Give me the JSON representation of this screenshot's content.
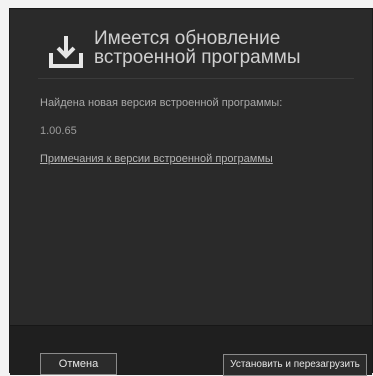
{
  "dialog": {
    "title": "Имеется обновление встроенной программы",
    "icon": "download-icon",
    "message": "Найдена новая версия встроенной программы:",
    "version": "1.00.65",
    "release_notes_link": "Примечания к версии встроенной программы"
  },
  "footer": {
    "cancel_label": "Отмена",
    "install_label": "Установить и перезагрузить"
  },
  "colors": {
    "dialog_bg": "#2a2a2a",
    "footer_bg": "#1f1f1f",
    "text": "#a9a9a9",
    "title": "#cfcfcf",
    "button_border": "#8a8a8a"
  }
}
